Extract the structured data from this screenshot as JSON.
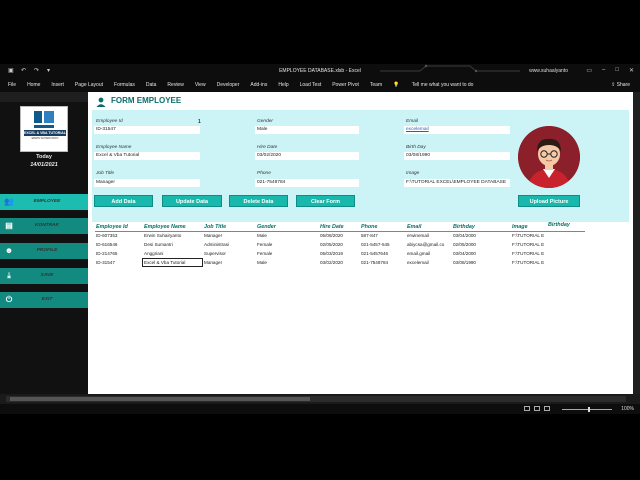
{
  "excel": {
    "title": "EMPLOYEE DATABASE.xlsb  -  Excel",
    "user": "www.suhaalyanto",
    "share": "Share",
    "ribbon_tabs": [
      "File",
      "Home",
      "Insert",
      "Page Layout",
      "Formulas",
      "Data",
      "Review",
      "View",
      "Developer",
      "Add-ins",
      "Help",
      "Load Test",
      "Power Pivot",
      "Team",
      "Tell me what you want to do"
    ],
    "zoom": "100%"
  },
  "sidebar": {
    "logo_banner": "EXCEL & VBA TUTORIAL",
    "logo_sub": "ERWIN SUHAIRYANTO",
    "today_label": "Today",
    "date": "14/01/2021",
    "items": [
      {
        "label": "EMPLOYEE",
        "icon": "people-icon"
      },
      {
        "label": "KONTRAK",
        "icon": "id-card-icon"
      },
      {
        "label": "PROFILE",
        "icon": "user-icon"
      },
      {
        "label": "SAVE",
        "icon": "download-icon"
      },
      {
        "label": "EXIT",
        "icon": "power-icon"
      }
    ]
  },
  "form": {
    "title": "FORM EMPLOYEE",
    "fields": {
      "employee_id": {
        "label": "Employee Id",
        "value": "ID-31547",
        "count": "1"
      },
      "employee_name": {
        "label": "Employee Name",
        "value": "Excel & Vba Tutorial"
      },
      "job_title": {
        "label": "Job Title",
        "value": "Manager"
      },
      "gender": {
        "label": "Gender",
        "value": "Male"
      },
      "hire_date": {
        "label": "Hire Date",
        "value": "03/02/2020"
      },
      "phone": {
        "label": "Phone",
        "value": "021-7548784"
      },
      "email": {
        "label": "Email",
        "value": "excelemail"
      },
      "birth_day": {
        "label": "Birth Day",
        "value": "03/08/1990"
      },
      "image": {
        "label": "Image",
        "value": "F:\\TUTORIAL EXCEL\\EMPLOYEE DATABASE"
      }
    },
    "buttons": {
      "add": "Add Data",
      "update": "Update Data",
      "delete": "Delete Data",
      "clear": "Clear Form",
      "upload": "Upload Picture"
    }
  },
  "table": {
    "headers": [
      "Employee Id",
      "Employee Name",
      "Job Title",
      "Gender",
      "Hire Date",
      "Phone",
      "Email",
      "Birthday",
      "Image",
      "Birthday"
    ],
    "rows": [
      [
        "ID-607353",
        "Erwin Suhairyanto",
        "Manager",
        "Male",
        "05/08/2020",
        "587-847",
        "erwinemail",
        "03/04/2000",
        "F:\\TUTORIAL E"
      ],
      [
        "ID-616546",
        "Desi Sumantri",
        "Administrasi",
        "Female",
        "02/05/2020",
        "021-5457-545",
        "abiycsa@gmail.co",
        "02/05/2000",
        "F:\\TUTORIAL E"
      ],
      [
        "ID-214765",
        "Anggriani",
        "Supervisor",
        "Female",
        "05/03/2019",
        "021-5457646",
        "email.gmail",
        "03/04/2000",
        "F:\\TUTORIAL E"
      ],
      [
        "ID-31547",
        "Excel & Vba Tutorial",
        "Manager",
        "Male",
        "03/02/2020",
        "021-7548784",
        "excelemail",
        "03/08/1990",
        "F:\\TUTORIAL E"
      ]
    ]
  }
}
